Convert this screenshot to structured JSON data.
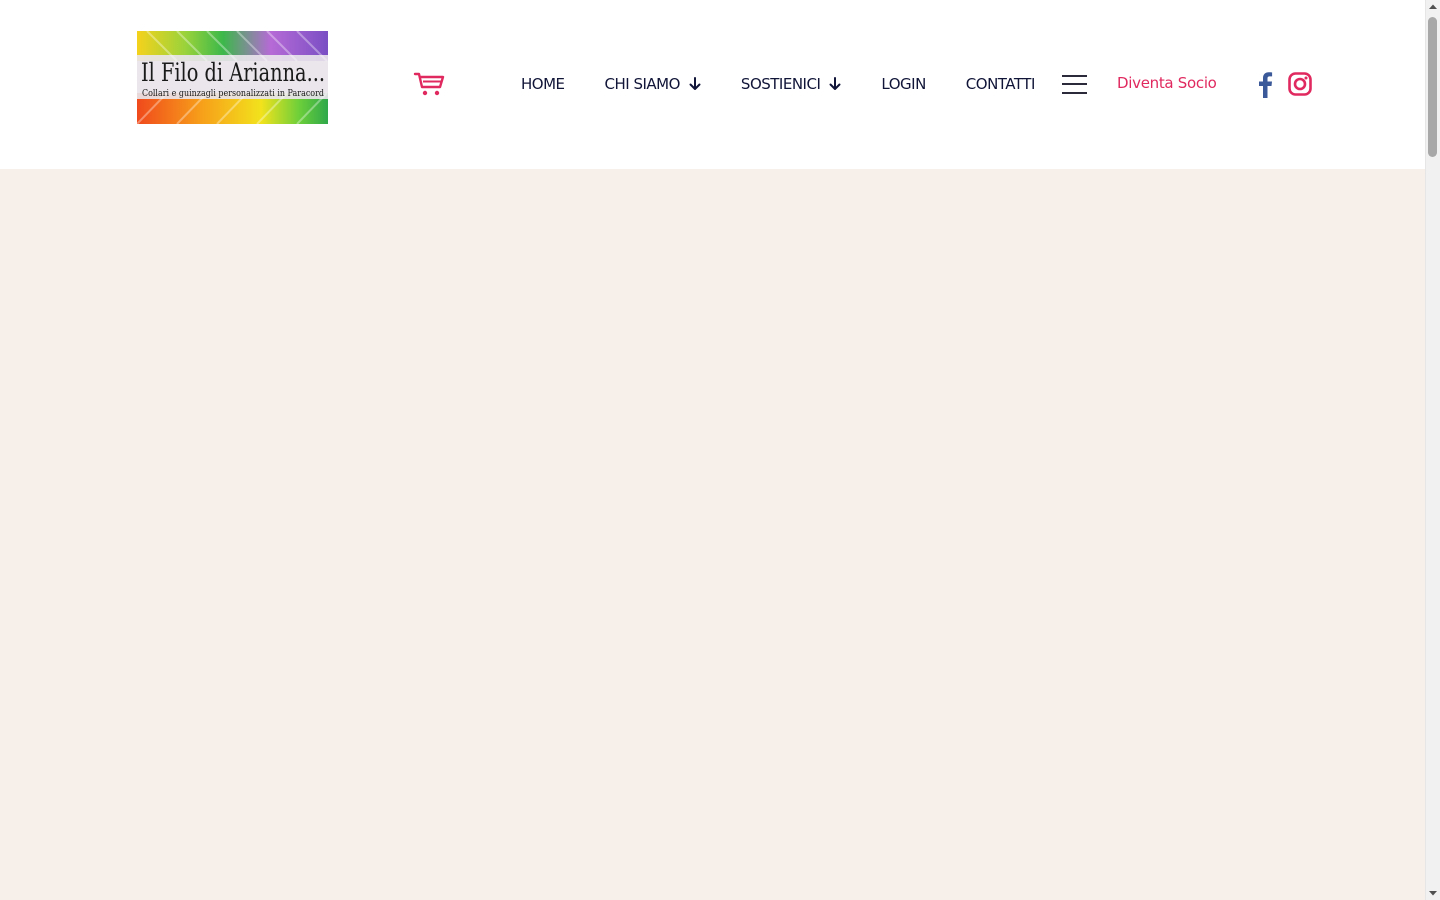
{
  "header": {
    "logo": {
      "title": "Il Filo di Arianna...",
      "subtitle": "Collari e guinzagli personalizzati in Paracord"
    },
    "cart_icon": "cart-icon",
    "nav": [
      {
        "label": "HOME",
        "has_dropdown": false
      },
      {
        "label": "CHI SIAMO",
        "has_dropdown": true
      },
      {
        "label": "SOSTIENICI",
        "has_dropdown": true
      },
      {
        "label": "LOGIN",
        "has_dropdown": false
      },
      {
        "label": "CONTATTI",
        "has_dropdown": false
      }
    ],
    "menu_icon": "hamburger-menu-icon",
    "cta_label": "Diventa Socio",
    "social": [
      "facebook-icon",
      "instagram-icon"
    ]
  },
  "colors": {
    "nav_text": "#111538",
    "accent": "#e0295f",
    "facebook": "#3b5998",
    "content_background": "#f7efea",
    "header_background": "#ffffff"
  }
}
